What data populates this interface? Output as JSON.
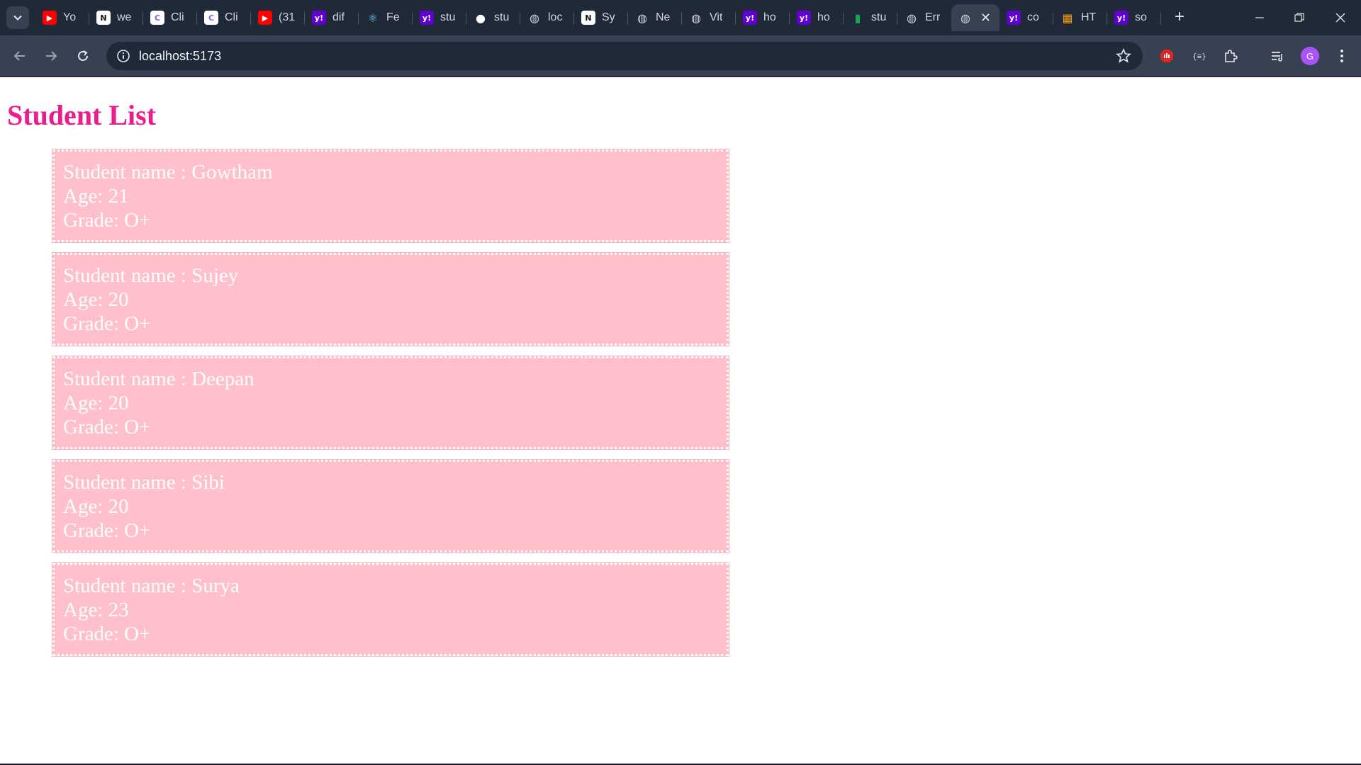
{
  "browser": {
    "tabs": [
      {
        "title": "Yo",
        "icon": "youtube-icon",
        "color": "#ff0000"
      },
      {
        "title": "we",
        "icon": "notion-icon",
        "color": "#ffffff"
      },
      {
        "title": "Cli",
        "icon": "clickup-icon",
        "color": "#ffffff"
      },
      {
        "title": "Cli",
        "icon": "clickup-icon",
        "color": "#ffffff"
      },
      {
        "title": "(31",
        "icon": "youtube-icon",
        "color": "#ff0000"
      },
      {
        "title": "dif",
        "icon": "yahoo-icon",
        "color": "#6001d2"
      },
      {
        "title": "Fe",
        "icon": "react-icon",
        "color": "#61dafb"
      },
      {
        "title": "stu",
        "icon": "yahoo-icon",
        "color": "#6001d2"
      },
      {
        "title": "stu",
        "icon": "github-icon",
        "color": "#ffffff"
      },
      {
        "title": "loc",
        "icon": "globe-icon",
        "color": "#d1d5db"
      },
      {
        "title": "Sy",
        "icon": "notion-icon",
        "color": "#ffffff"
      },
      {
        "title": "Ne",
        "icon": "globe-icon",
        "color": "#d1d5db"
      },
      {
        "title": "Vit",
        "icon": "globe-icon",
        "color": "#d1d5db"
      },
      {
        "title": "ho",
        "icon": "yahoo-icon",
        "color": "#6001d2"
      },
      {
        "title": "ho",
        "icon": "yahoo-icon",
        "color": "#6001d2"
      },
      {
        "title": "stu",
        "icon": "mongodb-icon",
        "color": "#13aa52"
      },
      {
        "title": "Err",
        "icon": "globe-icon",
        "color": "#d1d5db"
      },
      {
        "title": "",
        "icon": "globe-icon",
        "color": "#d1d5db",
        "active": true
      },
      {
        "title": "co",
        "icon": "yahoo-icon",
        "color": "#6001d2"
      },
      {
        "title": "HT",
        "icon": "grid-icon",
        "color": "#f59e0b"
      },
      {
        "title": "so",
        "icon": "yahoo-icon",
        "color": "#6001d2"
      }
    ],
    "url": "localhost:5173",
    "avatar_letter": "G"
  },
  "page": {
    "title": "Student List",
    "title_color": "#e91e8c",
    "card_color": "#ffc0cb",
    "students": [
      {
        "name_line": "Student name : Gowtham",
        "age_line": "Age: 21",
        "grade_line": "Grade: O+"
      },
      {
        "name_line": "Student name : Sujey",
        "age_line": "Age: 20",
        "grade_line": "Grade: O+"
      },
      {
        "name_line": "Student name : Deepan",
        "age_line": "Age: 20",
        "grade_line": "Grade: O+"
      },
      {
        "name_line": "Student name : Sibi",
        "age_line": "Age: 20",
        "grade_line": "Grade: O+"
      },
      {
        "name_line": "Student name : Surya",
        "age_line": "Age: 23",
        "grade_line": "Grade: O+"
      }
    ]
  }
}
